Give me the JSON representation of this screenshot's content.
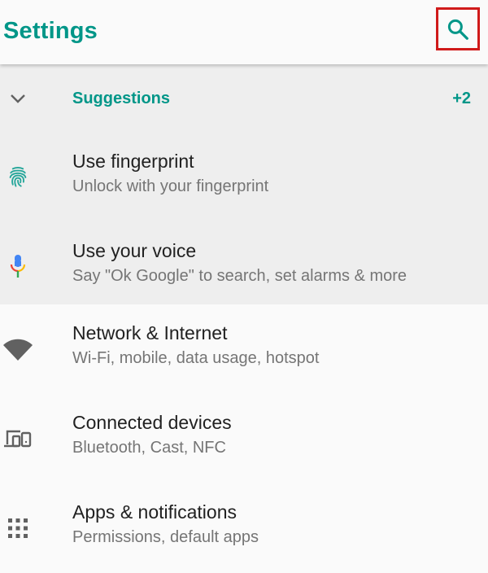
{
  "appbar": {
    "title": "Settings",
    "search_icon": "search-icon"
  },
  "suggestions": {
    "label": "Suggestions",
    "more_count": "+2",
    "items": [
      {
        "title": "Use fingerprint",
        "subtitle": "Unlock with your fingerprint",
        "icon": "fingerprint-icon"
      },
      {
        "title": "Use your voice",
        "subtitle": "Say \"Ok Google\" to search, set alarms & more",
        "icon": "microphone-icon"
      }
    ]
  },
  "settings": {
    "items": [
      {
        "title": "Network & Internet",
        "subtitle": "Wi-Fi, mobile, data usage, hotspot",
        "icon": "wifi-icon"
      },
      {
        "title": "Connected devices",
        "subtitle": "Bluetooth, Cast, NFC",
        "icon": "devices-icon"
      },
      {
        "title": "Apps & notifications",
        "subtitle": "Permissions, default apps",
        "icon": "apps-grid-icon"
      }
    ]
  },
  "colors": {
    "accent": "#009688",
    "highlight_border": "#d01a1a",
    "suggestion_bg": "#eeeeee",
    "page_bg": "#fafafa"
  }
}
